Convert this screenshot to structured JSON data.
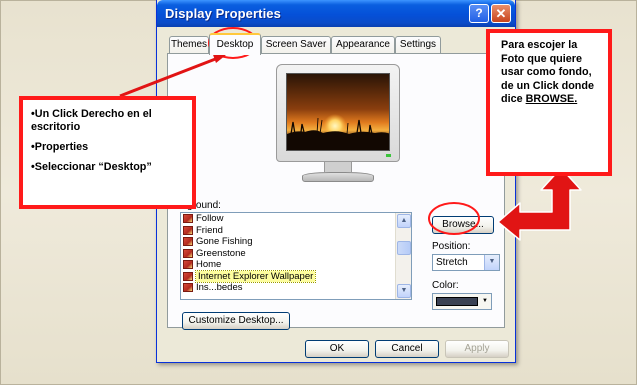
{
  "dialog": {
    "title": "Display Properties",
    "help_button": "?",
    "close_button": "✕",
    "tabs": [
      {
        "label": "Themes",
        "active": false
      },
      {
        "label": "Desktop",
        "active": true
      },
      {
        "label": "Screen Saver",
        "active": false
      },
      {
        "label": "Appearance",
        "active": false
      },
      {
        "label": "Settings",
        "active": false
      }
    ],
    "background_label": "kground:",
    "background_items": [
      {
        "label": "Follow",
        "selected": false
      },
      {
        "label": "Friend",
        "selected": false
      },
      {
        "label": "Gone Fishing",
        "selected": false
      },
      {
        "label": "Greenstone",
        "selected": false
      },
      {
        "label": "Home",
        "selected": false
      },
      {
        "label": "Internet Explorer Wallpaper",
        "selected": true
      },
      {
        "label": "Ins...bedes",
        "selected": false
      }
    ],
    "browse_button": "Browse...",
    "position_label": "Position:",
    "position_value": "Stretch",
    "color_label": "Color:",
    "color_value": "#3a4254",
    "customize_button": "Customize Desktop...",
    "ok_button": "OK",
    "cancel_button": "Cancel",
    "apply_button": "Apply"
  },
  "annotations": {
    "left_callout": [
      "•Un Click Derecho en el escritorio",
      "•Properties",
      "•Seleccionar “Desktop”"
    ],
    "right_callout_text": "Para escojer la Foto que quiere usar como fondo, de un Click donde dice ",
    "right_callout_emphasis": "BROWSE."
  },
  "colors": {
    "annotation_red": "#ff1a1a",
    "title_bar_blue": "#0550d8",
    "dialog_face": "#ece9d8"
  },
  "icons": {
    "help": "question-icon",
    "close": "close-icon",
    "list_item": "image-file-icon",
    "scroll_up": "chevron-up-icon",
    "scroll_down": "chevron-down-icon",
    "dropdown": "chevron-down-icon"
  }
}
